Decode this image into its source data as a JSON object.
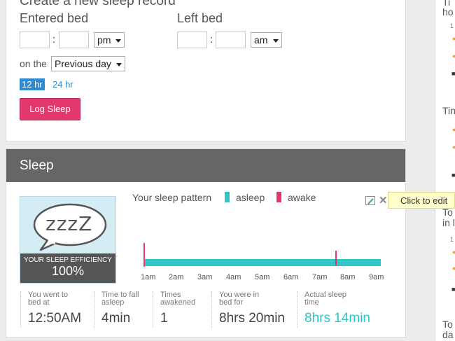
{
  "record": {
    "title": "Create a new sleep record",
    "entered_label": "Entered bed",
    "left_label": "Left bed",
    "entered_ampm": "pm",
    "left_ampm": "am",
    "colon": ":",
    "on_the": "on the",
    "day_select": "Previous day",
    "hr12": "12 hr",
    "hr24": "24 hr",
    "log_button": "Log Sleep"
  },
  "sleep": {
    "title": "Sleep",
    "zzz": "zzzZ",
    "efficiency_label": "YOUR SLEEP EFFICIENCY",
    "efficiency_value": "100%",
    "efficiency_fraction": 1.0,
    "pattern_label": "Your sleep pattern",
    "legend_asleep": "asleep",
    "legend_awake": "awake",
    "ticks": [
      "1am",
      "2am",
      "3am",
      "4am",
      "5am",
      "6am",
      "7am",
      "8am",
      "9am"
    ],
    "stats": [
      {
        "label": "You went to bed at",
        "value": "12:50AM"
      },
      {
        "label": "Time to fall asleep",
        "value": "4min"
      },
      {
        "label": "Times awakened",
        "value": "1"
      },
      {
        "label": "You were in bed for",
        "value": "8hrs 20min"
      },
      {
        "label": "Actual sleep time",
        "value": "8hrs 14min"
      }
    ],
    "tooltip": "Click to edit"
  },
  "right_column": {
    "text1": "Ti ho",
    "text2": "Tin",
    "text3": "To in l",
    "text4": "To da",
    "tiny": "1"
  },
  "colors": {
    "accent": "#2f8bd0",
    "asleep": "#2ec6c6",
    "awake": "#e2386d",
    "header": "#666666"
  }
}
